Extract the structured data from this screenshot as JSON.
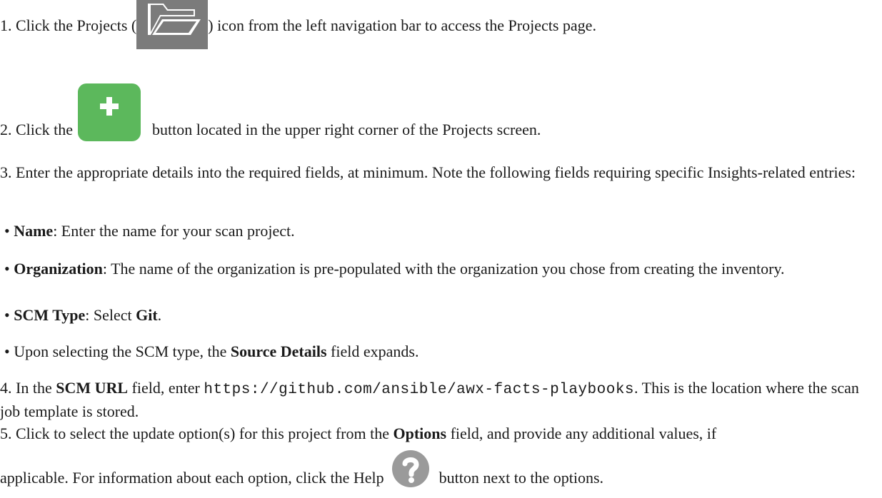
{
  "steps": [
    {
      "num": "1.",
      "before": "Click the Projects (",
      "after": ") icon from the left navigation bar to access the Projects page.",
      "icon": "folder-icon"
    },
    {
      "num": "2.",
      "before": "Click the",
      "after": "button located in the upper right corner of the Projects screen.",
      "icon": "add-icon"
    },
    {
      "num": "3.",
      "text": "Enter the appropriate details into the required fields, at minimum. Note the following fields requiring specific Insights-related entries:"
    },
    {
      "num": "4.",
      "before": "In the",
      "bold1": "SCM URL",
      "middle": "field, enter",
      "url": "https://github.com/ansible/awx-facts-playbooks",
      "after": ". This is the location where the scan job template is stored."
    },
    {
      "num": "5.",
      "before": "Click to select the update option(s) for this project from the",
      "bold1": "Options",
      "middle": "field, and provide any additional values, if",
      "line2_before": "applicable. For information about each option, click the Help",
      "line2_after": "button next to the options.",
      "icon": "help-icon"
    }
  ],
  "bullets": [
    {
      "label": "Name",
      "text": ": Enter the name for your scan project."
    },
    {
      "label": "Organization",
      "text": ": The name of the organization is pre-populated with the organization you chose from creating the inventory."
    },
    {
      "label": "SCM Type",
      "text": ": Select ",
      "value": "Git",
      "tail": "."
    },
    {
      "pre": "Upon selecting the SCM type, the ",
      "label": "Source Details",
      "text": " field expands."
    }
  ],
  "bullet_glyph": "•",
  "colors": {
    "text": "#1a1a1a",
    "folder_bg": "#7b7b7b",
    "add_green": "#5cb85c",
    "help_gray": "#9a9a9a"
  }
}
